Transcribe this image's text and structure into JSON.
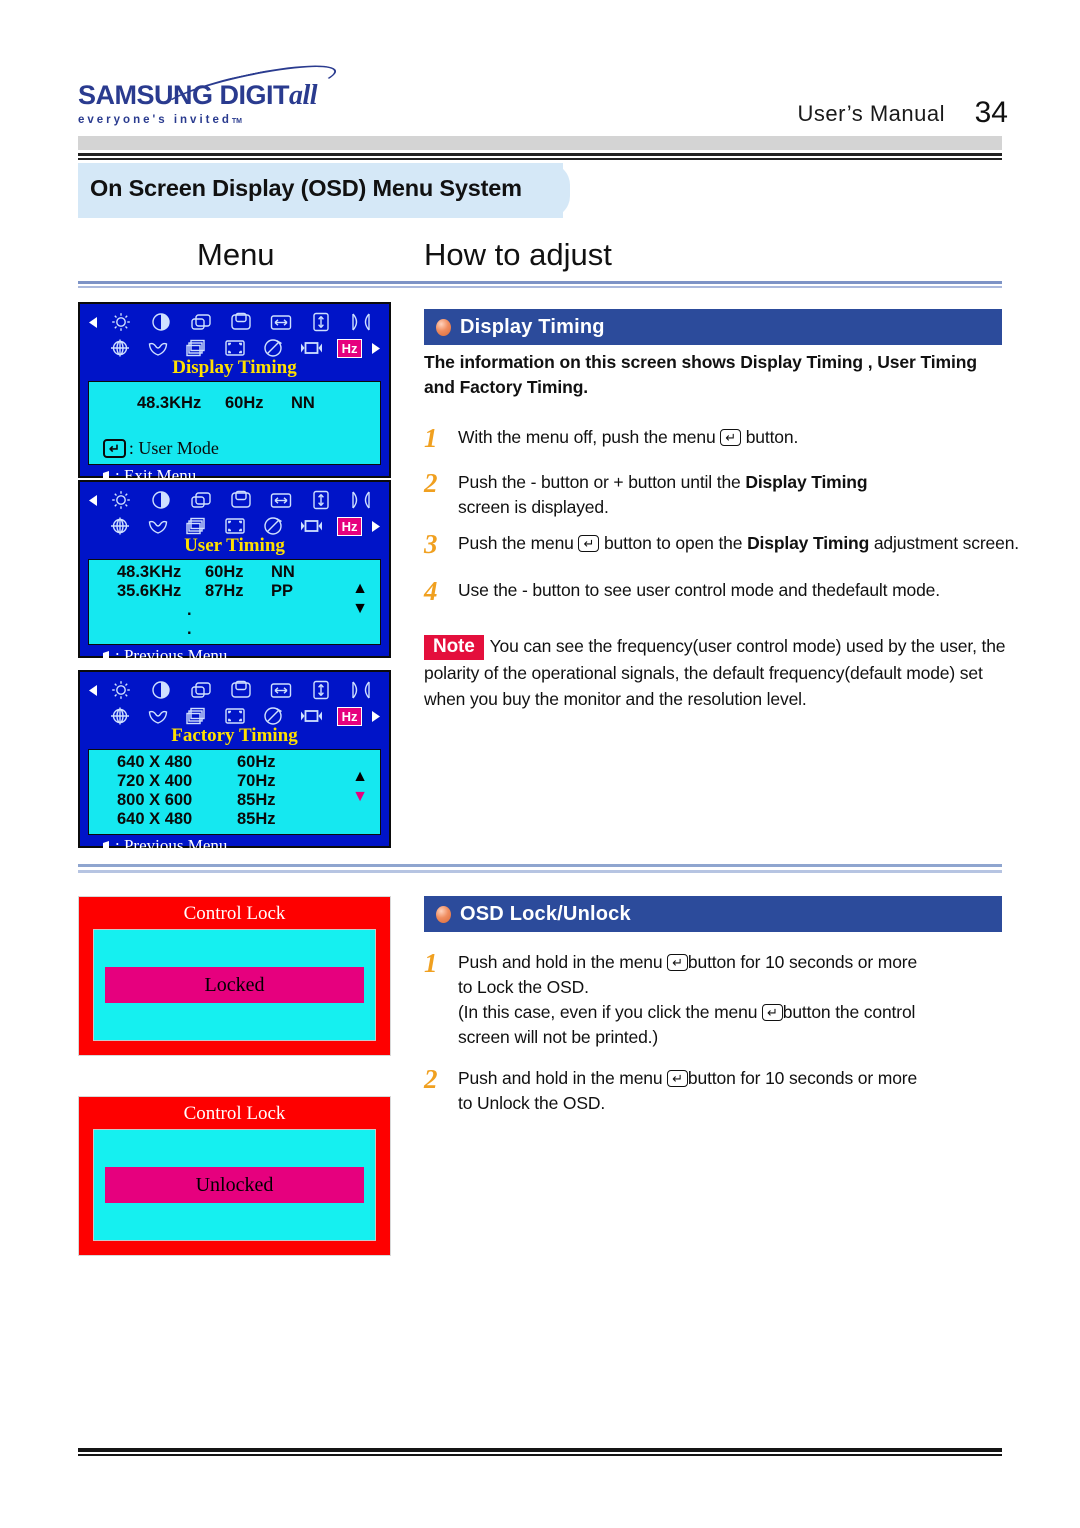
{
  "header": {
    "logo_main": "SAMSUNG DIGIT",
    "logo_main_italic": "all",
    "logo_tagline": "everyone's invited",
    "logo_tm": "TM",
    "manual_label": "User’s  Manual",
    "page_number": "34"
  },
  "section": {
    "title": "On Screen Display (OSD) Menu System",
    "col_menu": "Menu",
    "col_howto": "How to adjust"
  },
  "osd_screens": [
    {
      "name": "display-timing",
      "label": "Display Timing",
      "rows": [
        {
          "c1": "48.3KHz",
          "c2": "60Hz",
          "c3": "NN"
        }
      ],
      "enter_line": ": User Mode",
      "footer": ": Exit Menu",
      "has_scroll_arrows": false
    },
    {
      "name": "user-timing",
      "label": "User Timing",
      "rows": [
        {
          "c1": "48.3KHz",
          "c2": "60Hz",
          "c3": "NN"
        },
        {
          "c1": "35.6KHz",
          "c2": "87Hz",
          "c3": "PP"
        },
        {
          "c1": "",
          "c2": ".",
          "c3": ""
        },
        {
          "c1": "",
          "c2": ".",
          "c3": ""
        }
      ],
      "enter_line": "",
      "footer": ": Previous Menu",
      "has_scroll_arrows": true
    },
    {
      "name": "factory-timing",
      "label": "Factory Timing",
      "rows": [
        {
          "c1": "640 X 480",
          "c2": "60Hz",
          "c3": ""
        },
        {
          "c1": "720 X 400",
          "c2": "70Hz",
          "c3": ""
        },
        {
          "c1": "800 X 600",
          "c2": "85Hz",
          "c3": ""
        },
        {
          "c1": "640 X 480",
          "c2": "85Hz",
          "c3": ""
        }
      ],
      "enter_line": "",
      "footer": ": Previous Menu",
      "has_scroll_arrows": true
    }
  ],
  "osd_icons": {
    "row1": [
      "brightness-icon",
      "contrast-icon",
      "h-position-icon",
      "v-position-icon",
      "h-size-icon",
      "v-size-icon",
      "pincushion-icon"
    ],
    "row2": [
      "rotation-icon",
      "trapezoid-icon",
      "moire-icon",
      "zoom-icon",
      "degauss-icon",
      "osd-position-icon",
      "display-timing-hz-icon"
    ],
    "hz_label": "Hz",
    "highlight_color": "#e6007e",
    "panel_bg": "#0014c8",
    "panel_body_bg": "#15e8f0",
    "label_color": "#ffe000"
  },
  "display_timing_section": {
    "heading": "Display Timing",
    "intro": "The information on this screen shows Display Timing , User Timing and Factory Timing.",
    "steps": [
      {
        "n": "1",
        "text_parts": [
          {
            "t": "With the menu off, push the menu "
          },
          {
            "kbd": "↵"
          },
          {
            "t": " button."
          }
        ]
      },
      {
        "n": "2",
        "text_parts": [
          {
            "t": "Push the - button or  + button until the  "
          },
          {
            "b": "Display Timing"
          },
          {
            "t": "<br>screen is displayed."
          }
        ]
      },
      {
        "n": "3",
        "text_parts": [
          {
            "t": "Push the menu "
          },
          {
            "kbd": "↵"
          },
          {
            "t": " button to open the "
          },
          {
            "b": "Display Timing"
          },
          {
            "t": " adjustment screen."
          }
        ]
      },
      {
        "n": "4",
        "text_parts": [
          {
            "t": "Use the - button to see user control mode and thedefault mode."
          }
        ]
      }
    ],
    "note_tag": "Note",
    "note_text": "You can see the frequency(user control mode) used by the user, the polarity of the operational signals, the default frequency(default mode) set when you buy the monitor and the resolution level."
  },
  "osd_lock_section": {
    "heading": "OSD Lock/Unlock",
    "steps": [
      {
        "n": "1",
        "line1_a": "Push and hold in the menu ",
        "line1_b": "button for 10 seconds or more",
        "line2": "to Lock  the OSD.",
        "line3_a": "(In this case, even if you click the menu ",
        "line3_b": "button the control",
        "line4": "screen will not be printed.)"
      },
      {
        "n": "2",
        "line1_a": "Push and hold in the menu ",
        "line1_b": "button for 10 seconds or more",
        "line2": "to Unlock the OSD."
      }
    ]
  },
  "control_lock_boxes": [
    {
      "title": "Control Lock",
      "state": "Locked"
    },
    {
      "title": "Control Lock",
      "state": "Unlocked"
    }
  ],
  "colors": {
    "heading_blue": "#2c4b9b",
    "section_bar": "#d5e8f7",
    "note_red": "#e40f3c",
    "step_number": "#f0a020",
    "control_lock_red": "#fe0000",
    "control_lock_cyan": "#15f0f0",
    "control_lock_magenta": "#e6007e"
  }
}
